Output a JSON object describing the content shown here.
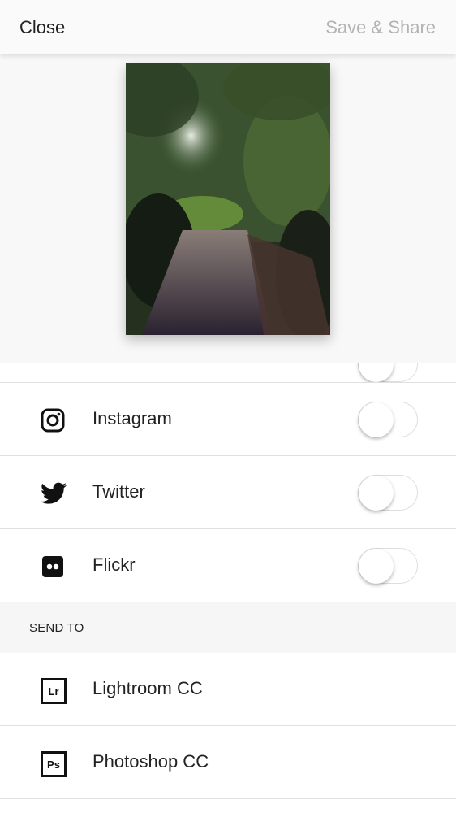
{
  "header": {
    "close_label": "Close",
    "save_share_label": "Save & Share"
  },
  "preview": {
    "image_description": "forest path photo"
  },
  "share_to": {
    "items": [
      {
        "label": "Instagram",
        "icon": "instagram-icon",
        "enabled": false
      },
      {
        "label": "Twitter",
        "icon": "twitter-icon",
        "enabled": false
      },
      {
        "label": "Flickr",
        "icon": "flickr-icon",
        "enabled": false
      }
    ]
  },
  "send_to": {
    "title": "SEND TO",
    "items": [
      {
        "label": "Lightroom CC",
        "icon": "lightroom-icon",
        "badge": "Lr"
      },
      {
        "label": "Photoshop CC",
        "icon": "photoshop-icon",
        "badge": "Ps"
      }
    ]
  }
}
